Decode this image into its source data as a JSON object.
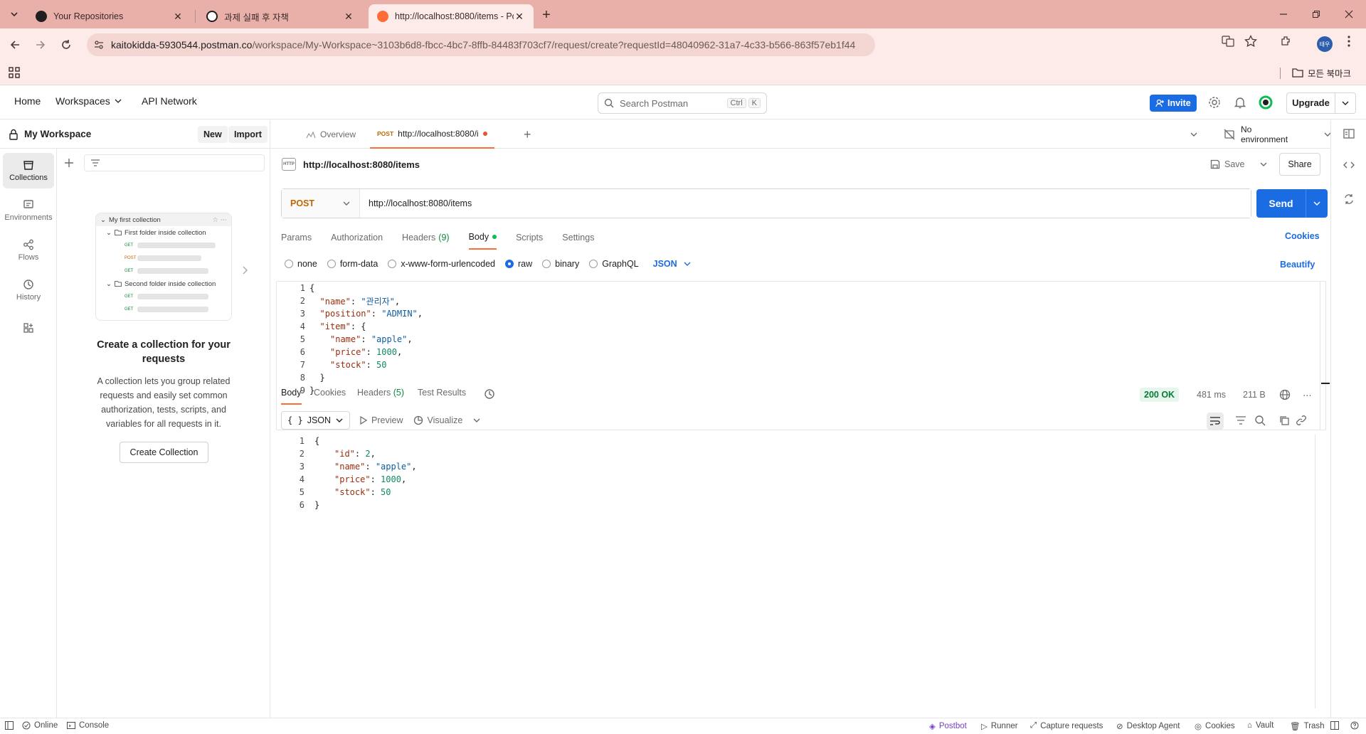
{
  "browser": {
    "tabs": [
      {
        "title": "Your Repositories"
      },
      {
        "title": "과제 실패 후 자책"
      },
      {
        "title": "http://localhost:8080/items - Postman"
      }
    ],
    "url_host": "kaitokidda-5930544.postman.co",
    "url_path": "/workspace/My-Workspace~3103b6d8-fbcc-4bc7-8ffb-84483f703cf7/request/create?requestId=48040962-31a7-4c33-b566-863f57eb1f44",
    "profile_initials": "태우",
    "bookmarks_label": "모든 북마크"
  },
  "header": {
    "nav": [
      "Home",
      "Workspaces",
      "API Network"
    ],
    "search_placeholder": "Search Postman",
    "search_kbd": [
      "Ctrl",
      "K"
    ],
    "invite_label": "Invite",
    "upgrade_label": "Upgrade"
  },
  "sidebar": {
    "workspace_name": "My Workspace",
    "new_label": "New",
    "import_label": "Import",
    "rail": [
      {
        "label": "Collections",
        "icon": "collections-icon"
      },
      {
        "label": "Environments",
        "icon": "environments-icon"
      },
      {
        "label": "Flows",
        "icon": "flows-icon"
      },
      {
        "label": "History",
        "icon": "history-icon"
      }
    ],
    "illustration": {
      "collection": "My first collection",
      "folder1": "First folder inside collection",
      "folder2": "Second folder inside collection",
      "methods": [
        "GET",
        "POST",
        "GET",
        "GET",
        "GET"
      ]
    },
    "empty_title": "Create a collection for your requests",
    "empty_desc": "A collection lets you group related requests and easily set common authorization, tests, scripts, and variables for all requests in it.",
    "create_button": "Create Collection"
  },
  "main": {
    "tabs": {
      "overview": "Overview",
      "active_method": "POST",
      "active_title": "http://localhost:8080/i"
    },
    "environment": "No environment",
    "request_title": "http://localhost:8080/items",
    "http_badge": "HTTP",
    "save_label": "Save",
    "share_label": "Share",
    "method": "POST",
    "url": "http://localhost:8080/items",
    "send_label": "Send",
    "subtabs": [
      {
        "label": "Params"
      },
      {
        "label": "Authorization"
      },
      {
        "label": "Headers",
        "count": "(9)"
      },
      {
        "label": "Body"
      },
      {
        "label": "Scripts"
      },
      {
        "label": "Settings"
      }
    ],
    "cookies_link": "Cookies",
    "body_types": [
      "none",
      "form-data",
      "x-www-form-urlencoded",
      "raw",
      "binary",
      "GraphQL"
    ],
    "body_selected": "raw",
    "body_format": "JSON",
    "beautify_label": "Beautify",
    "request_body": [
      {
        "n": "1",
        "indent": 0,
        "parts": [
          {
            "t": "{",
            "c": "p"
          }
        ]
      },
      {
        "n": "2",
        "indent": 1,
        "parts": [
          {
            "t": "\"name\"",
            "c": "k"
          },
          {
            "t": ": ",
            "c": "p"
          },
          {
            "t": "\"관리자\"",
            "c": "s"
          },
          {
            "t": ",",
            "c": "p"
          }
        ]
      },
      {
        "n": "3",
        "indent": 1,
        "parts": [
          {
            "t": "\"position\"",
            "c": "k"
          },
          {
            "t": ": ",
            "c": "p"
          },
          {
            "t": "\"ADMIN\"",
            "c": "s"
          },
          {
            "t": ",",
            "c": "p"
          }
        ]
      },
      {
        "n": "4",
        "indent": 1,
        "parts": [
          {
            "t": "\"item\"",
            "c": "k"
          },
          {
            "t": ": {",
            "c": "p"
          }
        ]
      },
      {
        "n": "5",
        "indent": 2,
        "parts": [
          {
            "t": "\"name\"",
            "c": "k"
          },
          {
            "t": ": ",
            "c": "p"
          },
          {
            "t": "\"apple\"",
            "c": "s"
          },
          {
            "t": ",",
            "c": "p"
          }
        ]
      },
      {
        "n": "6",
        "indent": 2,
        "parts": [
          {
            "t": "\"price\"",
            "c": "k"
          },
          {
            "t": ": ",
            "c": "p"
          },
          {
            "t": "1000",
            "c": "n"
          },
          {
            "t": ",",
            "c": "p"
          }
        ]
      },
      {
        "n": "7",
        "indent": 2,
        "parts": [
          {
            "t": "\"stock\"",
            "c": "k"
          },
          {
            "t": ": ",
            "c": "p"
          },
          {
            "t": "50",
            "c": "n"
          }
        ]
      },
      {
        "n": "8",
        "indent": 1,
        "parts": [
          {
            "t": "}",
            "c": "p"
          }
        ]
      },
      {
        "n": "9",
        "indent": 0,
        "parts": [
          {
            "t": "}",
            "c": "p"
          }
        ]
      }
    ],
    "response": {
      "tabs": [
        {
          "label": "Body"
        },
        {
          "label": "Cookies"
        },
        {
          "label": "Headers",
          "count": "(5)"
        },
        {
          "label": "Test Results"
        }
      ],
      "status": "200 OK",
      "time": "481 ms",
      "size": "211 B",
      "format": "JSON",
      "preview_label": "Preview",
      "visualize_label": "Visualize",
      "body": [
        {
          "n": "1",
          "indent": 0,
          "parts": [
            {
              "t": "{",
              "c": "p"
            }
          ]
        },
        {
          "n": "2",
          "indent": 2,
          "parts": [
            {
              "t": "\"id\"",
              "c": "k"
            },
            {
              "t": ": ",
              "c": "p"
            },
            {
              "t": "2",
              "c": "n"
            },
            {
              "t": ",",
              "c": "p"
            }
          ]
        },
        {
          "n": "3",
          "indent": 2,
          "parts": [
            {
              "t": "\"name\"",
              "c": "k"
            },
            {
              "t": ": ",
              "c": "p"
            },
            {
              "t": "\"apple\"",
              "c": "s"
            },
            {
              "t": ",",
              "c": "p"
            }
          ]
        },
        {
          "n": "4",
          "indent": 2,
          "parts": [
            {
              "t": "\"price\"",
              "c": "k"
            },
            {
              "t": ": ",
              "c": "p"
            },
            {
              "t": "1000",
              "c": "n"
            },
            {
              "t": ",",
              "c": "p"
            }
          ]
        },
        {
          "n": "5",
          "indent": 2,
          "parts": [
            {
              "t": "\"stock\"",
              "c": "k"
            },
            {
              "t": ": ",
              "c": "p"
            },
            {
              "t": "50",
              "c": "n"
            }
          ]
        },
        {
          "n": "6",
          "indent": 0,
          "parts": [
            {
              "t": "}",
              "c": "p"
            }
          ]
        }
      ]
    }
  },
  "statusbar": {
    "left": [
      "Online",
      "Console"
    ],
    "right": [
      "Postbot",
      "Runner",
      "Capture requests",
      "Desktop Agent",
      "Cookies",
      "Vault",
      "Trash"
    ]
  },
  "colors": {
    "accent": "#ff6c37",
    "primary": "#1b6ce3",
    "post_method": "#c46500",
    "browser_frame": "#e8b0a8"
  }
}
